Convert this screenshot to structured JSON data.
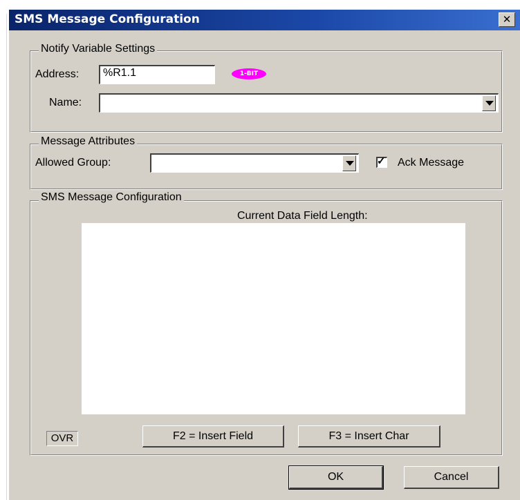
{
  "window": {
    "title": "SMS Message Configuration",
    "close_glyph": "✕"
  },
  "notify": {
    "group_label": "Notify Variable Settings",
    "address_label": "Address:",
    "address_value": "%R1.1",
    "badge_text": "1-BIT",
    "name_label": "Name:",
    "name_value": ""
  },
  "attributes": {
    "group_label": "Message Attributes",
    "allowed_group_label": "Allowed Group:",
    "allowed_group_value": "",
    "ack_checked": true,
    "ack_label": "Ack Message"
  },
  "sms": {
    "group_label": "SMS Message Configuration",
    "current_length_label": "Current Data Field Length:",
    "message_text": "",
    "ovr_label": "OVR",
    "insert_field_label": "F2 = Insert Field",
    "insert_char_label": "F3 = Insert Char"
  },
  "footer": {
    "ok_label": "OK",
    "cancel_label": "Cancel"
  },
  "colors": {
    "titlebar": "#0a246a",
    "face": "#d4d0c8",
    "badge": "#ff00ff"
  }
}
